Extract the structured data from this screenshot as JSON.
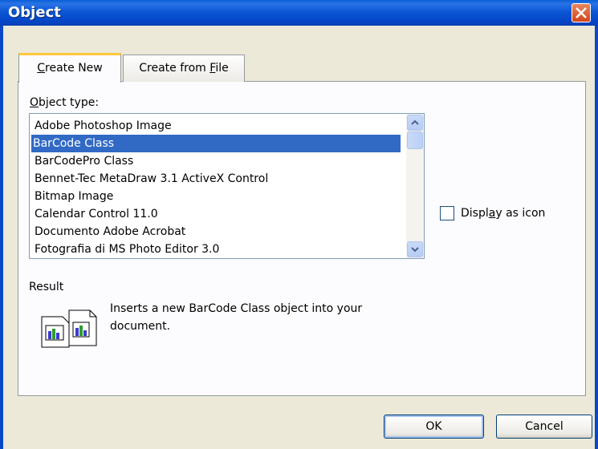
{
  "window": {
    "title": "Object"
  },
  "tabs": [
    {
      "label": "Create New",
      "underline_char": "C",
      "rest": "reate New",
      "active": true
    },
    {
      "label": "Create from File",
      "prefix": "Create from ",
      "underline_char": "F",
      "rest": "ile",
      "active": false
    }
  ],
  "object_type": {
    "label_first": "O",
    "label_rest": "bject type:",
    "items": [
      "Adobe Photoshop Image",
      "BarCode Class",
      "BarCodePro Class",
      "Bennet-Tec MetaDraw 3.1 ActiveX Control",
      "Bitmap Image",
      "Calendar Control 11.0",
      "Documento Adobe Acrobat",
      "Fotografia di MS Photo Editor 3.0"
    ],
    "selected": "BarCode Class"
  },
  "display_as_icon": {
    "prefix": "Displ",
    "underline_char": "a",
    "rest": "y as icon",
    "checked": false
  },
  "result": {
    "label": "Result",
    "text": "Inserts a new BarCode Class object into your document."
  },
  "buttons": {
    "ok": "OK",
    "cancel": "Cancel"
  },
  "icons": {
    "close": "close-icon",
    "result": "insert-object-icon",
    "scroll_up": "chevron-up-icon",
    "scroll_down": "chevron-down-icon"
  }
}
